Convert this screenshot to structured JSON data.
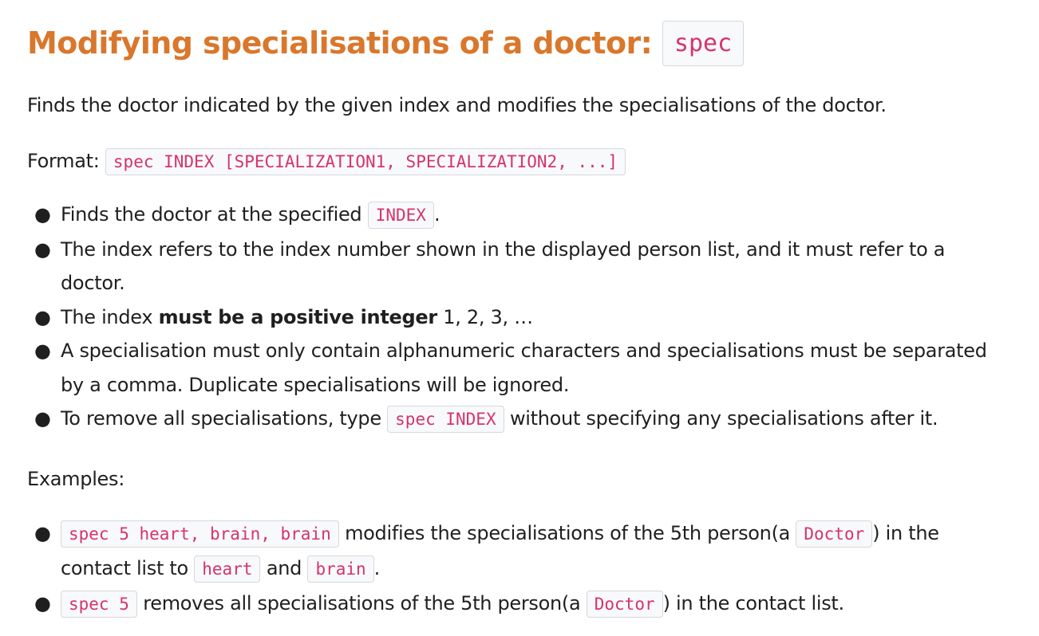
{
  "heading": {
    "text": "Modifying specialisations of a doctor:",
    "code": "spec"
  },
  "description": "Finds the doctor indicated by the given index and modifies the specialisations of the doctor.",
  "format": {
    "label": "Format:",
    "code": "spec INDEX [SPECIALIZATION1, SPECIALIZATION2, ...]"
  },
  "rules": {
    "r1_text": "Finds the doctor at the specified",
    "r1_code": "INDEX",
    "r1_end": ".",
    "r2_text": "The index refers to the index number shown in the displayed person list, and it must refer to a doctor.",
    "r3_pre": "The index",
    "r3_bold": "must be a positive integer",
    "r3_post": "1, 2, 3, …",
    "r4_text": "A specialisation must only contain alphanumeric characters and specialisations must be separated by a comma. Duplicate specialisations will be ignored.",
    "r5_pre": "To remove all specialisations, type",
    "r5_code": "spec INDEX",
    "r5_post": "without specifying any specialisations after it."
  },
  "examples": {
    "label": "Examples:",
    "e1_code": "spec 5 heart, brain, brain",
    "e1_text1": "modifies the specialisations of the 5th person(a",
    "e1_code2": "Doctor",
    "e1_text2": ") in the contact list to",
    "e1_code3": "heart",
    "e1_and": "and",
    "e1_code4": "brain",
    "e1_end": ".",
    "e2_code": "spec 5",
    "e2_text1": "removes all specialisations of the 5th person(a",
    "e2_code2": "Doctor",
    "e2_text2": ") in the contact list."
  }
}
